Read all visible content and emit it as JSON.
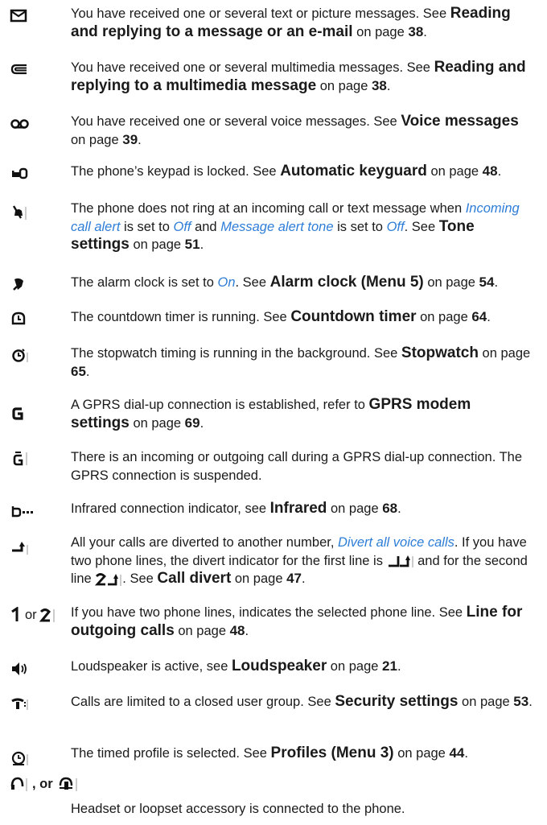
{
  "rows": [
    {
      "icon": "envelope-icon",
      "t1": "You have received one or several text or picture messages. See ",
      "b1": "Reading and replying to a message or an e-mail",
      "t2": " on page ",
      "n": "38",
      "t3": "."
    },
    {
      "icon": "multimedia-message-icon",
      "t1": "You have received one or several multimedia messages. See ",
      "b1": "Reading and replying to a multimedia message",
      "t2": " on page ",
      "n": "38",
      "t3": "."
    },
    {
      "icon": "voicemail-icon",
      "t1": "You have received one or several voice messages. See ",
      "b1": "Voice messages",
      "t2": " on page ",
      "n": "39",
      "t3": "."
    },
    {
      "icon": "keypad-lock-icon",
      "t1": "The phone’s keypad is locked. See ",
      "b1": "Automatic keyguard",
      "t2": " on page ",
      "n": "48",
      "t3": "."
    },
    {
      "icon": "silent-icon",
      "t1": "The phone does not ring at an incoming call or text message when ",
      "i1": "Incoming call alert",
      "t2": " is set to ",
      "i2": "Off",
      "t3": " and ",
      "i3": "Message alert tone",
      "t4": " is set to ",
      "i4": "Off",
      "t5": ". See ",
      "b1": "Tone settings",
      "t6": " on page ",
      "n": "51",
      "t7": "."
    },
    {
      "icon": "alarm-bell-icon",
      "t1": "The alarm clock is set to ",
      "i1": "On",
      "t2": ". See ",
      "b1": "Alarm clock (Menu 5)",
      "t3": " on page ",
      "n": "54",
      "t4": "."
    },
    {
      "icon": "countdown-timer-icon",
      "t1": "The countdown timer is running. See ",
      "b1": "Countdown timer",
      "t2": " on page ",
      "n": "64",
      "t3": "."
    },
    {
      "icon": "stopwatch-icon",
      "t1": "The stopwatch timing is running in the background. See ",
      "b1": "Stopwatch",
      "t2": " on page ",
      "n": "65",
      "t3": "."
    },
    {
      "icon": "gprs-icon",
      "t1": "A GPRS dial-up connection is established, refer to ",
      "b1": "GPRS modem settings",
      "t2": " on page ",
      "n": "69",
      "t3": "."
    },
    {
      "icon": "gprs-suspended-icon",
      "t1": "There is an incoming or outgoing call during a GPRS dial-up connection. The GPRS connection is suspended."
    },
    {
      "icon": "infrared-icon",
      "t1": "Infrared connection indicator, see ",
      "b1": "Infrared",
      "t2": " on page ",
      "n": "68",
      "t3": "."
    },
    {
      "icon": "divert-icon",
      "t1": "All your calls are diverted to another number, ",
      "i1": "Divert all voice calls",
      "t2": ". If you have two phone lines, the divert indicator for the first line is ",
      "t3": " and for the second line ",
      "t4": ". See ",
      "b1": "Call divert",
      "t5": " on page ",
      "n": "47",
      "t6": "."
    },
    {
      "icon": "line-1-icon",
      "or": " or ",
      "t1": "If you have two phone lines, indicates the selected phone line. See ",
      "b1": "Line for outgoing calls",
      "t2": " on page ",
      "n": "48",
      "t3": "."
    },
    {
      "icon": "loudspeaker-icon",
      "t1": "Loudspeaker is active, see ",
      "b1": "Loudspeaker",
      "t2": " on page ",
      "n": "21",
      "t3": "."
    },
    {
      "icon": "closed-user-group-icon",
      "t1": "Calls are limited to a closed user group. See ",
      "b1": "Security settings",
      "t2": " on page ",
      "n": "53",
      "t3": "."
    },
    {
      "icon": "timed-profile-icon",
      "t1": "The timed profile is selected. See ",
      "b1": "Profiles (Menu 3)",
      "t2": " on page ",
      "n": "44",
      "t3": "."
    },
    {
      "icon": "headset-icon",
      "or": ", or ",
      "t1": "Headset or loopset accessory is connected to the phone."
    }
  ]
}
